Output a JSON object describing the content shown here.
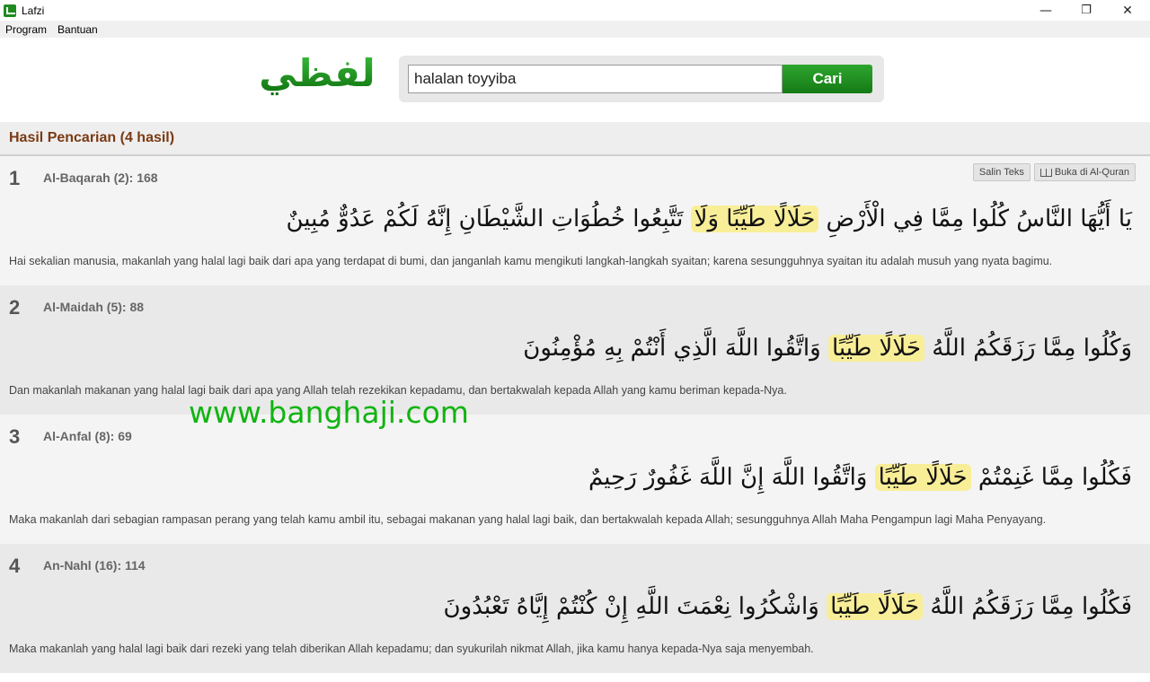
{
  "window": {
    "title": "Lafzi",
    "minimize": "—",
    "maximize": "❐",
    "close": "✕"
  },
  "menu": {
    "items": [
      "Program",
      "Bantuan"
    ]
  },
  "logo": {
    "text": "لفظي"
  },
  "search": {
    "value": "halalan toyyiba",
    "button": "Cari"
  },
  "results": {
    "heading": "Hasil Pencarian (4 hasil)",
    "actions": {
      "copy": "Salin Teks",
      "open": "Buka di Al-Quran"
    },
    "items": [
      {
        "number": "1",
        "ref": "Al-Baqarah (2): 168",
        "arabic_pre": "يَا أَيُّهَا النَّاسُ كُلُوا مِمَّا فِي الْأَرْضِ ",
        "arabic_hl": "حَلَالًا طَيِّبًا وَلَا",
        "arabic_post": " تَتَّبِعُوا خُطُوَاتِ الشَّيْطَانِ إِنَّهُ لَكُمْ عَدُوٌّ مُبِينٌ",
        "translation": "Hai sekalian manusia, makanlah yang halal lagi baik dari apa yang terdapat di bumi, dan janganlah kamu mengikuti langkah-langkah syaitan; karena sesungguhnya syaitan itu adalah musuh yang nyata bagimu."
      },
      {
        "number": "2",
        "ref": "Al-Maidah (5): 88",
        "arabic_pre": "وَكُلُوا مِمَّا رَزَقَكُمُ اللَّهُ ",
        "arabic_hl": "حَلَالًا طَيِّبًا",
        "arabic_post": " وَاتَّقُوا اللَّهَ الَّذِي أَنْتُمْ بِهِ مُؤْمِنُونَ",
        "translation": "Dan makanlah makanan yang halal lagi baik dari apa yang Allah telah rezekikan kepadamu, dan bertakwalah kepada Allah yang kamu beriman kepada-Nya."
      },
      {
        "number": "3",
        "ref": "Al-Anfal (8): 69",
        "arabic_pre": "فَكُلُوا مِمَّا غَنِمْتُمْ ",
        "arabic_hl": "حَلَالًا طَيِّبًا",
        "arabic_post": " وَاتَّقُوا اللَّهَ إِنَّ اللَّهَ غَفُورٌ رَحِيمٌ",
        "translation": "Maka makanlah dari sebagian rampasan perang yang telah kamu ambil itu, sebagai makanan yang halal lagi baik, dan bertakwalah kepada Allah; sesungguhnya Allah Maha Pengampun lagi Maha Penyayang."
      },
      {
        "number": "4",
        "ref": "An-Nahl (16): 114",
        "arabic_pre": "فَكُلُوا مِمَّا رَزَقَكُمُ اللَّهُ ",
        "arabic_hl": "حَلَالًا طَيِّبًا",
        "arabic_post": " وَاشْكُرُوا نِعْمَتَ اللَّهِ إِنْ كُنْتُمْ إِيَّاهُ تَعْبُدُونَ",
        "translation": "Maka makanlah yang halal lagi baik dari rezeki yang telah diberikan Allah kepadamu; dan syukurilah nikmat Allah, jika kamu hanya kepada-Nya saja menyembah."
      }
    ]
  },
  "watermark": "www.banghaji.com",
  "colors": {
    "accent": "#1a8c1a",
    "heading": "#7a3a14",
    "highlight": "#f9ee98"
  }
}
